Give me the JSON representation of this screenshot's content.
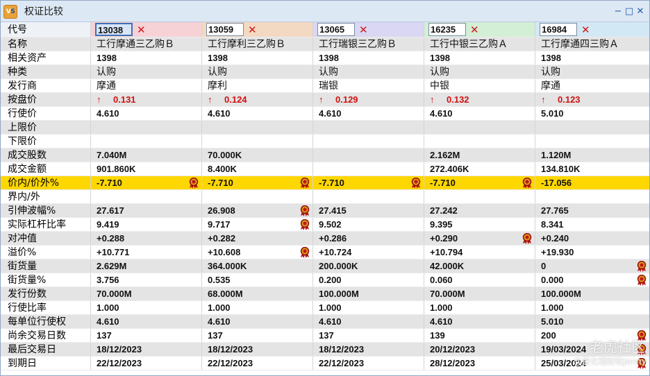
{
  "window": {
    "title": "权证比较",
    "icon_label_v": "V",
    "icon_label_s": "S",
    "minimize": "−",
    "maximize": "□",
    "close": "✕"
  },
  "header": {
    "label": "代号",
    "codes": [
      "13038",
      "13059",
      "13065",
      "16235",
      "16984"
    ],
    "remove_glyph": "✕"
  },
  "rows": [
    {
      "label": "名称",
      "kind": "text",
      "values": [
        "工行摩通三乙购Ｂ",
        "工行摩利三乙购Ｂ",
        "工行瑞银三乙购Ｂ",
        "工行中银三乙购Ａ",
        "工行摩通四三购Ａ"
      ]
    },
    {
      "label": "相关资产",
      "kind": "num",
      "values": [
        "1398",
        "1398",
        "1398",
        "1398",
        "1398"
      ]
    },
    {
      "label": "种类",
      "kind": "text",
      "values": [
        "认购",
        "认购",
        "认购",
        "认购",
        "认购"
      ]
    },
    {
      "label": "发行商",
      "kind": "text",
      "values": [
        "摩通",
        "摩利",
        "瑞银",
        "中银",
        "摩通"
      ]
    },
    {
      "label": "按盘价",
      "kind": "bid",
      "values": [
        "0.131",
        "0.124",
        "0.129",
        "0.132",
        "0.123"
      ]
    },
    {
      "label": "行使价",
      "kind": "num",
      "values": [
        "4.610",
        "4.610",
        "4.610",
        "4.610",
        "5.010"
      ]
    },
    {
      "label": "上限价",
      "kind": "num",
      "values": [
        "",
        "",
        "",
        "",
        ""
      ]
    },
    {
      "label": "下限价",
      "kind": "num",
      "values": [
        "",
        "",
        "",
        "",
        ""
      ]
    },
    {
      "label": "成交股数",
      "kind": "num",
      "values": [
        "7.040M",
        "70.000K",
        "",
        "2.162M",
        "1.120M"
      ]
    },
    {
      "label": "成交金额",
      "kind": "num",
      "values": [
        "901.860K",
        "8.400K",
        "",
        "272.406K",
        "134.810K"
      ]
    },
    {
      "label": "价内/价外%",
      "kind": "num",
      "highlight": true,
      "values": [
        "-7.710",
        "-7.710",
        "-7.710",
        "-7.710",
        "-17.056"
      ],
      "medals": [
        true,
        true,
        true,
        true,
        false
      ]
    },
    {
      "label": "界内/外",
      "kind": "num",
      "values": [
        "",
        "",
        "",
        "",
        ""
      ]
    },
    {
      "label": "引伸波幅%",
      "kind": "num",
      "values": [
        "27.617",
        "26.908",
        "27.415",
        "27.242",
        "27.765"
      ],
      "medals": [
        false,
        true,
        false,
        false,
        false
      ]
    },
    {
      "label": "实际杠杆比率",
      "kind": "num",
      "values": [
        "9.419",
        "9.717",
        "9.502",
        "9.395",
        "8.341"
      ],
      "medals": [
        false,
        true,
        false,
        false,
        false
      ]
    },
    {
      "label": "对冲值",
      "kind": "num",
      "values": [
        "+0.288",
        "+0.282",
        "+0.286",
        "+0.290",
        "+0.240"
      ],
      "medals": [
        false,
        false,
        false,
        true,
        false
      ]
    },
    {
      "label": "溢价%",
      "kind": "num",
      "values": [
        "+10.771",
        "+10.608",
        "+10.724",
        "+10.794",
        "+19.930"
      ],
      "medals": [
        false,
        true,
        false,
        false,
        false
      ]
    },
    {
      "label": "街货量",
      "kind": "num",
      "values": [
        "2.629M",
        "364.000K",
        "200.000K",
        "42.000K",
        "0"
      ],
      "medals": [
        false,
        false,
        false,
        false,
        true
      ]
    },
    {
      "label": "街货量%",
      "kind": "num",
      "values": [
        "3.756",
        "0.535",
        "0.200",
        "0.060",
        "0.000"
      ],
      "medals": [
        false,
        false,
        false,
        false,
        true
      ]
    },
    {
      "label": "发行份数",
      "kind": "num",
      "values": [
        "70.000M",
        "68.000M",
        "100.000M",
        "70.000M",
        "100.000M"
      ]
    },
    {
      "label": "行使比率",
      "kind": "num",
      "values": [
        "1.000",
        "1.000",
        "1.000",
        "1.000",
        "1.000"
      ]
    },
    {
      "label": "每单位行使权",
      "kind": "num",
      "values": [
        "4.610",
        "4.610",
        "4.610",
        "4.610",
        "5.010"
      ]
    },
    {
      "label": "尚余交易日数",
      "kind": "num",
      "values": [
        "137",
        "137",
        "137",
        "139",
        "200"
      ],
      "medals": [
        false,
        false,
        false,
        false,
        true
      ]
    },
    {
      "label": "最后交易日",
      "kind": "num",
      "values": [
        "18/12/2023",
        "18/12/2023",
        "18/12/2023",
        "20/12/2023",
        "19/03/2024"
      ],
      "medals": [
        false,
        false,
        false,
        false,
        true
      ]
    },
    {
      "label": "到期日",
      "kind": "num",
      "values": [
        "22/12/2023",
        "22/12/2023",
        "22/12/2023",
        "28/12/2023",
        "25/03/2024"
      ],
      "medals": [
        false,
        false,
        false,
        false,
        true
      ]
    }
  ],
  "colors": {
    "highlight_row": "#ffd700",
    "alt_row": "#e4e4e4",
    "bid_red": "#d01010",
    "remove_red": "#d01818",
    "header_col_1": "#f6d2d6",
    "header_col_2": "#f3d9c2",
    "header_col_3": "#d9d7f3",
    "header_col_4": "#d3efd6",
    "header_col_5": "#d3e8f5"
  },
  "icons": {
    "bid_arrow": "up-arrow-icon",
    "medal": "award-medal-icon",
    "remove": "close-icon"
  },
  "watermark": {
    "main": "老虎社区",
    "sub": "@量化理财轮Jenny"
  }
}
